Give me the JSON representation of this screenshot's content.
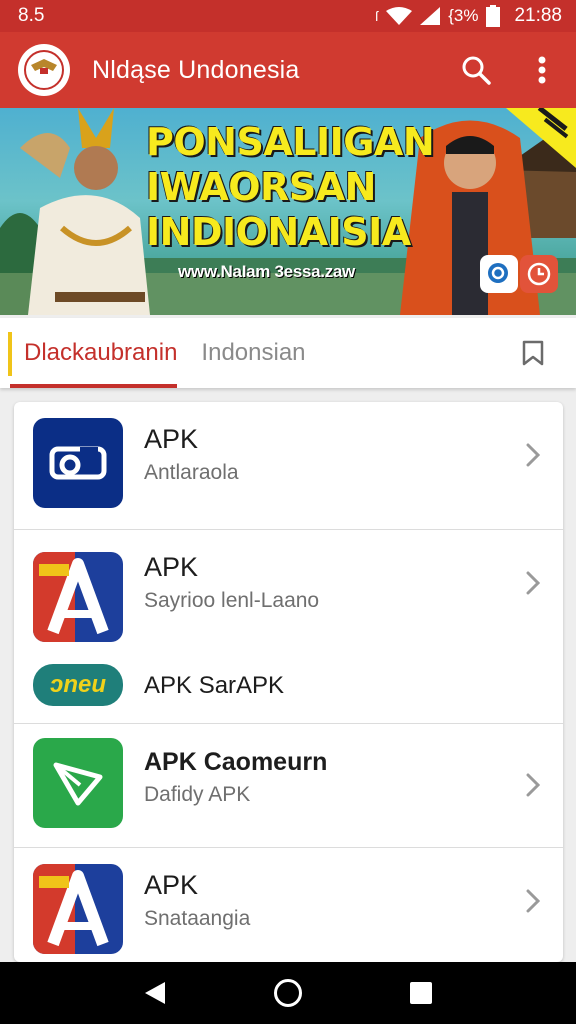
{
  "status_bar": {
    "left_text": "8.5",
    "battery": "{3%",
    "time": "21:88"
  },
  "app_bar": {
    "title": "Nldąse Undonesia",
    "icons": [
      "search-icon",
      "more-vert-icon"
    ]
  },
  "banner": {
    "headline_lines": [
      "PONSALIIGAN",
      "IWAORSAN",
      "INDIONAISIA"
    ],
    "url_text": "www.NaIam 3essa.zaw"
  },
  "tabs": [
    {
      "label": "Dlackaubranin",
      "active": true
    },
    {
      "label": "Indonsian",
      "active": false
    }
  ],
  "list": [
    {
      "title": "APK",
      "subtitle": "Antlaraola",
      "icon": "whistle-app-icon",
      "icon_color": "#0b2e86",
      "chevron": true
    },
    {
      "title": "APK",
      "subtitle": "Sayrioo lenl-Laano",
      "icon": "a-logo-app-icon",
      "icon_color": "#1d3f9c",
      "chevron": true
    },
    {
      "title": "APK SarAPK",
      "subtitle": "",
      "icon": "jnpu-badge-icon",
      "icon_color": "#1f7f7a",
      "chevron": false
    },
    {
      "title": "APK Caomeurn",
      "subtitle": "Dafidy APK",
      "icon": "paper-plane-app-icon",
      "icon_color": "#2aa84a",
      "chevron": true
    },
    {
      "title": "APK",
      "subtitle": "Snataangia",
      "icon": "a-logo-app-icon",
      "icon_color": "#1d3f9c",
      "chevron": true
    }
  ],
  "jnpu_badge_text": "ɔneu",
  "colors": {
    "primary": "#d03a30",
    "status": "#c4302b",
    "accent_yellow": "#f7ea1e"
  },
  "nav_bar": {
    "icons": [
      "back-icon",
      "home-icon",
      "recents-icon"
    ]
  }
}
